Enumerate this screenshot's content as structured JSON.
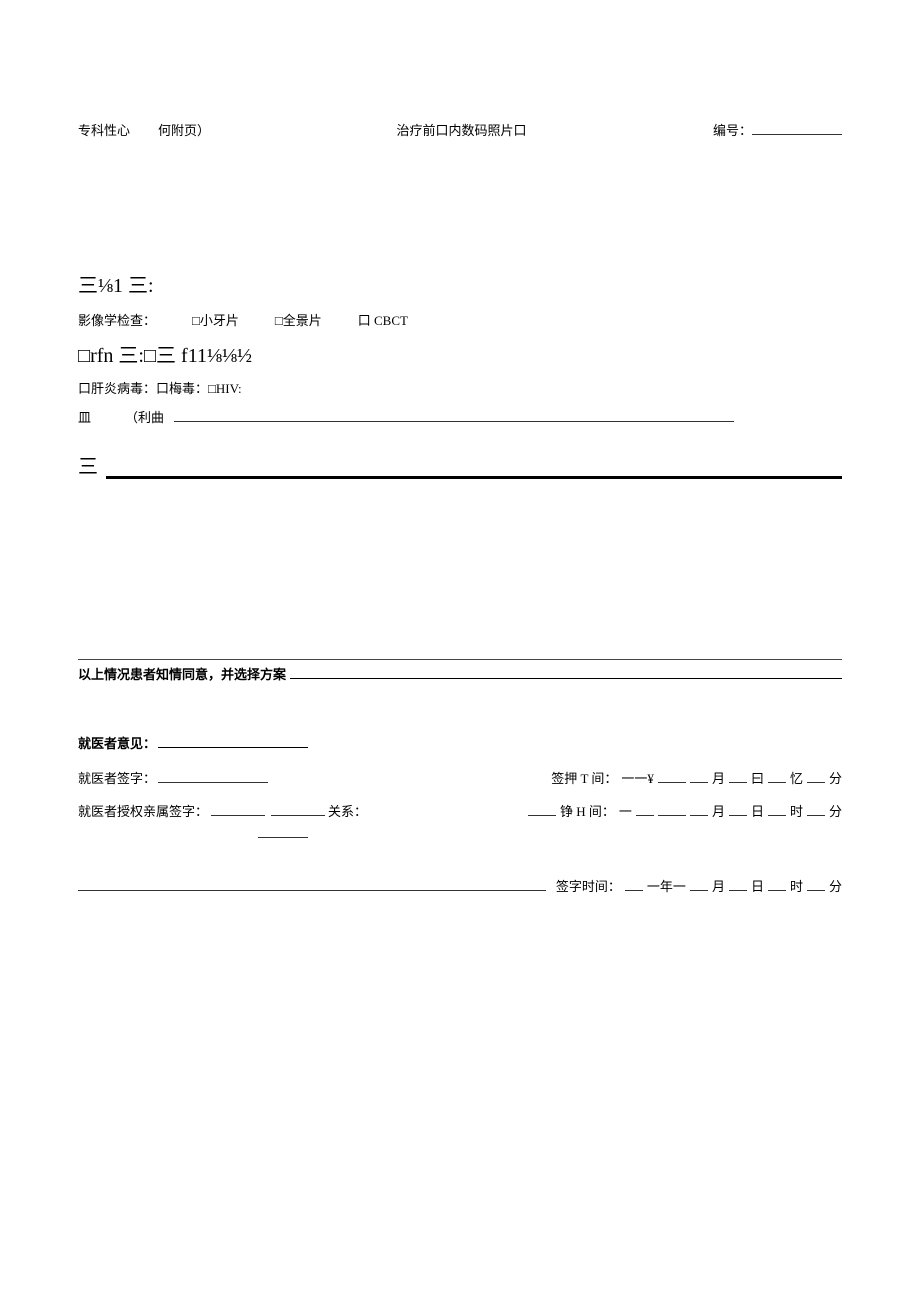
{
  "header": {
    "left1": "专科性心",
    "left2": "何附页）",
    "center": "治疗前口内数码照片口",
    "rightLabel": "编号："
  },
  "line1": "三⅛1 三:",
  "imaging": {
    "label": "影像学检查：",
    "opt1": "□小牙片",
    "opt2": "□全景片",
    "opt3": "口 CBCT"
  },
  "line3": "□rfn 三:□三 f11⅛⅛½",
  "virus": {
    "a": "口肝炎病毒：",
    "b": "口梅毒：",
    "c": "□HIV:"
  },
  "blood": {
    "a": "皿",
    "b": "（利曲"
  },
  "ruleLabel": "三",
  "consent": "以上情况患者知情同意，并选择方案",
  "opinionLabel": "就医者意见：",
  "sig1": {
    "leftLabel": "就医者签字：",
    "timeLabel": "签押 T 间：",
    "pre": "一一¥",
    "m": "月",
    "d": "曰",
    "x": "忆",
    "f": "分"
  },
  "sig2": {
    "leftLabel": "就医者授权亲属签字：",
    "relLabel": "关系：",
    "timeLabel": "铮 H 间：",
    "pre": "一",
    "m": "月",
    "d": "日",
    "h": "时",
    "f": "分"
  },
  "sig3": {
    "timeLabel": "签字时间：",
    "pre": "一年一",
    "m": "月",
    "d": "日",
    "h": "时",
    "f": "分"
  }
}
